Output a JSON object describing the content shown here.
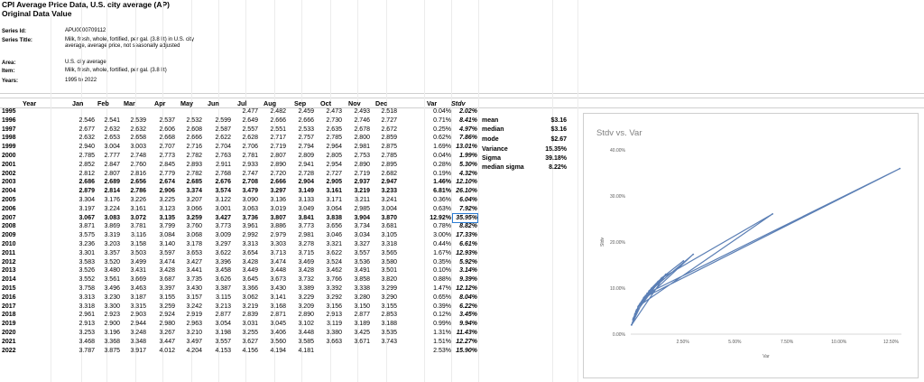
{
  "header": {
    "title": "CPI Average Price Data, U.S. city average (AP)",
    "subtitle": "Original Data Value"
  },
  "meta": [
    {
      "label": "Series Id:",
      "value": "APU0000709112"
    },
    {
      "label": "Series Title:",
      "value": "Milk, fresh, whole, fortified, per gal. (3.8 lit) in U.S. city average, average price, not seasonally adjusted"
    },
    {
      "label": "Area:",
      "value": "U.S. city average"
    },
    {
      "label": "Item:",
      "value": "Milk, fresh, whole, fortified, per gal. (3.8 lit)"
    },
    {
      "label": "Years:",
      "value": "1995 to 2022"
    }
  ],
  "columns": [
    "Year",
    "Jan",
    "Feb",
    "Mar",
    "Apr",
    "May",
    "Jun",
    "Jul",
    "Aug",
    "Sep",
    "Oct",
    "Nov",
    "Dec",
    "Var",
    "Stdv"
  ],
  "rows": [
    {
      "year": "1995",
      "bold": false,
      "m": [
        "",
        "",
        "",
        "",
        "",
        "",
        "2.477",
        "2.482",
        "2.459",
        "2.473",
        "2.493",
        "2.518"
      ],
      "var": "0.04%",
      "sd": "2.02%"
    },
    {
      "year": "1996",
      "bold": false,
      "m": [
        "2.546",
        "2.541",
        "2.539",
        "2.537",
        "2.532",
        "2.599",
        "2.649",
        "2.666",
        "2.666",
        "2.730",
        "2.746",
        "2.727"
      ],
      "var": "0.71%",
      "sd": "8.41%"
    },
    {
      "year": "1997",
      "bold": false,
      "m": [
        "2.677",
        "2.632",
        "2.632",
        "2.606",
        "2.608",
        "2.587",
        "2.557",
        "2.551",
        "2.533",
        "2.635",
        "2.678",
        "2.672"
      ],
      "var": "0.25%",
      "sd": "4.97%"
    },
    {
      "year": "1998",
      "bold": false,
      "m": [
        "2.632",
        "2.653",
        "2.658",
        "2.668",
        "2.666",
        "2.622",
        "2.628",
        "2.717",
        "2.757",
        "2.785",
        "2.800",
        "2.859"
      ],
      "var": "0.62%",
      "sd": "7.86%"
    },
    {
      "year": "1999",
      "bold": false,
      "m": [
        "2.940",
        "3.004",
        "3.003",
        "2.707",
        "2.716",
        "2.704",
        "2.706",
        "2.719",
        "2.794",
        "2.964",
        "2.981",
        "2.875"
      ],
      "var": "1.69%",
      "sd": "13.01%"
    },
    {
      "year": "2000",
      "bold": false,
      "m": [
        "2.785",
        "2.777",
        "2.748",
        "2.773",
        "2.782",
        "2.763",
        "2.781",
        "2.807",
        "2.809",
        "2.805",
        "2.753",
        "2.785"
      ],
      "var": "0.04%",
      "sd": "1.99%"
    },
    {
      "year": "2001",
      "bold": false,
      "m": [
        "2.852",
        "2.847",
        "2.760",
        "2.845",
        "2.893",
        "2.911",
        "2.933",
        "2.890",
        "2.941",
        "2.954",
        "2.890",
        "2.895"
      ],
      "var": "0.28%",
      "sd": "5.30%"
    },
    {
      "year": "2002",
      "bold": false,
      "m": [
        "2.812",
        "2.807",
        "2.816",
        "2.779",
        "2.782",
        "2.768",
        "2.747",
        "2.720",
        "2.728",
        "2.727",
        "2.719",
        "2.682"
      ],
      "var": "0.19%",
      "sd": "4.32%"
    },
    {
      "year": "2003",
      "bold": true,
      "m": [
        "2.686",
        "2.689",
        "2.656",
        "2.674",
        "2.685",
        "2.676",
        "2.708",
        "2.666",
        "2.904",
        "2.905",
        "2.937",
        "2.947"
      ],
      "var": "1.46%",
      "sd": "12.10%"
    },
    {
      "year": "2004",
      "bold": true,
      "m": [
        "2.879",
        "2.814",
        "2.786",
        "2.906",
        "3.374",
        "3.574",
        "3.479",
        "3.297",
        "3.149",
        "3.161",
        "3.219",
        "3.233"
      ],
      "var": "6.81%",
      "sd": "26.10%"
    },
    {
      "year": "2005",
      "bold": false,
      "m": [
        "3.304",
        "3.176",
        "3.226",
        "3.225",
        "3.207",
        "3.122",
        "3.090",
        "3.136",
        "3.133",
        "3.171",
        "3.211",
        "3.241"
      ],
      "var": "0.36%",
      "sd": "6.04%"
    },
    {
      "year": "2006",
      "bold": false,
      "m": [
        "3.197",
        "3.224",
        "3.161",
        "3.123",
        "3.066",
        "3.001",
        "3.063",
        "3.019",
        "3.049",
        "3.064",
        "2.985",
        "3.004"
      ],
      "var": "0.63%",
      "sd": "7.92%"
    },
    {
      "year": "2007",
      "bold": true,
      "m": [
        "3.067",
        "3.083",
        "3.072",
        "3.135",
        "3.259",
        "3.427",
        "3.736",
        "3.807",
        "3.841",
        "3.838",
        "3.904",
        "3.870"
      ],
      "var": "12.92%",
      "sd": "35.95%"
    },
    {
      "year": "2008",
      "bold": false,
      "m": [
        "3.871",
        "3.869",
        "3.781",
        "3.799",
        "3.760",
        "3.773",
        "3.961",
        "3.886",
        "3.773",
        "3.656",
        "3.734",
        "3.681"
      ],
      "var": "0.78%",
      "sd": "8.82%"
    },
    {
      "year": "2009",
      "bold": false,
      "m": [
        "3.575",
        "3.319",
        "3.116",
        "3.084",
        "3.068",
        "3.009",
        "2.992",
        "2.979",
        "2.981",
        "3.046",
        "3.034",
        "3.105"
      ],
      "var": "3.00%",
      "sd": "17.33%"
    },
    {
      "year": "2010",
      "bold": false,
      "m": [
        "3.236",
        "3.203",
        "3.158",
        "3.140",
        "3.178",
        "3.297",
        "3.313",
        "3.303",
        "3.278",
        "3.321",
        "3.327",
        "3.318"
      ],
      "var": "0.44%",
      "sd": "6.61%"
    },
    {
      "year": "2011",
      "bold": false,
      "m": [
        "3.301",
        "3.357",
        "3.503",
        "3.597",
        "3.653",
        "3.622",
        "3.654",
        "3.713",
        "3.715",
        "3.622",
        "3.557",
        "3.565"
      ],
      "var": "1.67%",
      "sd": "12.93%"
    },
    {
      "year": "2012",
      "bold": false,
      "m": [
        "3.583",
        "3.520",
        "3.499",
        "3.474",
        "3.427",
        "3.396",
        "3.428",
        "3.474",
        "3.469",
        "3.524",
        "3.536",
        "3.580"
      ],
      "var": "0.35%",
      "sd": "5.92%"
    },
    {
      "year": "2013",
      "bold": false,
      "m": [
        "3.526",
        "3.480",
        "3.431",
        "3.428",
        "3.441",
        "3.458",
        "3.449",
        "3.448",
        "3.428",
        "3.462",
        "3.491",
        "3.501"
      ],
      "var": "0.10%",
      "sd": "3.14%"
    },
    {
      "year": "2014",
      "bold": false,
      "m": [
        "3.552",
        "3.561",
        "3.669",
        "3.687",
        "3.735",
        "3.626",
        "3.645",
        "3.673",
        "3.732",
        "3.766",
        "3.858",
        "3.820"
      ],
      "var": "0.88%",
      "sd": "9.39%"
    },
    {
      "year": "2015",
      "bold": false,
      "m": [
        "3.758",
        "3.496",
        "3.463",
        "3.397",
        "3.430",
        "3.387",
        "3.366",
        "3.430",
        "3.389",
        "3.392",
        "3.338",
        "3.299",
        "3.310"
      ],
      "var": "1.47%",
      "sd": "12.12%"
    },
    {
      "year": "2016",
      "bold": false,
      "m": [
        "3.313",
        "3.230",
        "3.187",
        "3.155",
        "3.157",
        "3.115",
        "3.062",
        "3.141",
        "3.229",
        "3.292",
        "3.280",
        "3.290"
      ],
      "var": "0.65%",
      "sd": "8.04%"
    },
    {
      "year": "2017",
      "bold": false,
      "m": [
        "3.318",
        "3.300",
        "3.315",
        "3.259",
        "3.242",
        "3.213",
        "3.219",
        "3.168",
        "3.209",
        "3.156",
        "3.150",
        "3.155"
      ],
      "var": "0.39%",
      "sd": "6.22%"
    },
    {
      "year": "2018",
      "bold": false,
      "m": [
        "2.961",
        "2.923",
        "2.903",
        "2.924",
        "2.919",
        "2.877",
        "2.839",
        "2.871",
        "2.890",
        "2.913",
        "2.877",
        "2.853"
      ],
      "var": "0.12%",
      "sd": "3.45%"
    },
    {
      "year": "2019",
      "bold": false,
      "m": [
        "2.913",
        "2.900",
        "2.944",
        "2.980",
        "2.963",
        "3.054",
        "3.031",
        "3.045",
        "3.102",
        "3.119",
        "3.189",
        "3.188"
      ],
      "var": "0.99%",
      "sd": "9.94%"
    },
    {
      "year": "2020",
      "bold": false,
      "m": [
        "3.253",
        "3.196",
        "3.248",
        "3.267",
        "3.210",
        "3.198",
        "3.255",
        "3.406",
        "3.448",
        "3.380",
        "3.425",
        "3.535"
      ],
      "var": "1.31%",
      "sd": "11.43%"
    },
    {
      "year": "2021",
      "bold": false,
      "m": [
        "3.468",
        "3.368",
        "3.348",
        "3.447",
        "3.497",
        "3.557",
        "3.627",
        "3.560",
        "3.585",
        "3.663",
        "3.671",
        "3.743"
      ],
      "var": "1.51%",
      "sd": "12.27%"
    },
    {
      "year": "2022",
      "bold": false,
      "m": [
        "3.787",
        "3.875",
        "3.917",
        "4.012",
        "4.204",
        "4.153",
        "4.156",
        "4.194",
        "4.181",
        "",
        "",
        ""
      ],
      "var": "2.53%",
      "sd": "15.90%"
    }
  ],
  "stats": [
    {
      "label": "mean",
      "value": "$3.16"
    },
    {
      "label": "median",
      "value": "$3.16"
    },
    {
      "label": "mode",
      "value": "$2.67"
    },
    {
      "label": "Variance",
      "value": "15.35%"
    },
    {
      "label": "Sigma",
      "value": "39.18%"
    },
    {
      "label": "median sigma",
      "value": "8.22%"
    }
  ],
  "chart_data": {
    "type": "line",
    "title": "Stdv vs. Var",
    "xlabel": "Var",
    "ylabel": "Stdv",
    "xlim": [
      0,
      13
    ],
    "ylim": [
      0,
      40
    ],
    "x_ticks": [
      "2.50%",
      "5.00%",
      "7.50%",
      "10.00%",
      "12.50%"
    ],
    "y_ticks": [
      "0.00%",
      "10.00%",
      "20.00%",
      "30.00%",
      "40.00%"
    ],
    "grid": false,
    "legend": "none",
    "series_color": "#5b7fb5",
    "series": [
      {
        "x": [
          0.04,
          0.71,
          0.25,
          0.62,
          1.69,
          0.04,
          0.28,
          0.19,
          1.46,
          6.81,
          0.36,
          0.63,
          12.92,
          0.78,
          3.0,
          0.44,
          1.67,
          0.35,
          0.1,
          0.88,
          1.47,
          0.65,
          0.39,
          0.12,
          0.99,
          1.31,
          1.51,
          2.53
        ],
        "y": [
          2.02,
          8.41,
          4.97,
          7.86,
          13.01,
          1.99,
          5.3,
          4.32,
          12.1,
          26.1,
          6.04,
          7.92,
          35.95,
          8.82,
          17.33,
          6.61,
          12.93,
          5.92,
          3.14,
          9.39,
          12.12,
          8.04,
          6.22,
          3.45,
          9.94,
          11.43,
          12.27,
          15.9
        ]
      }
    ]
  }
}
